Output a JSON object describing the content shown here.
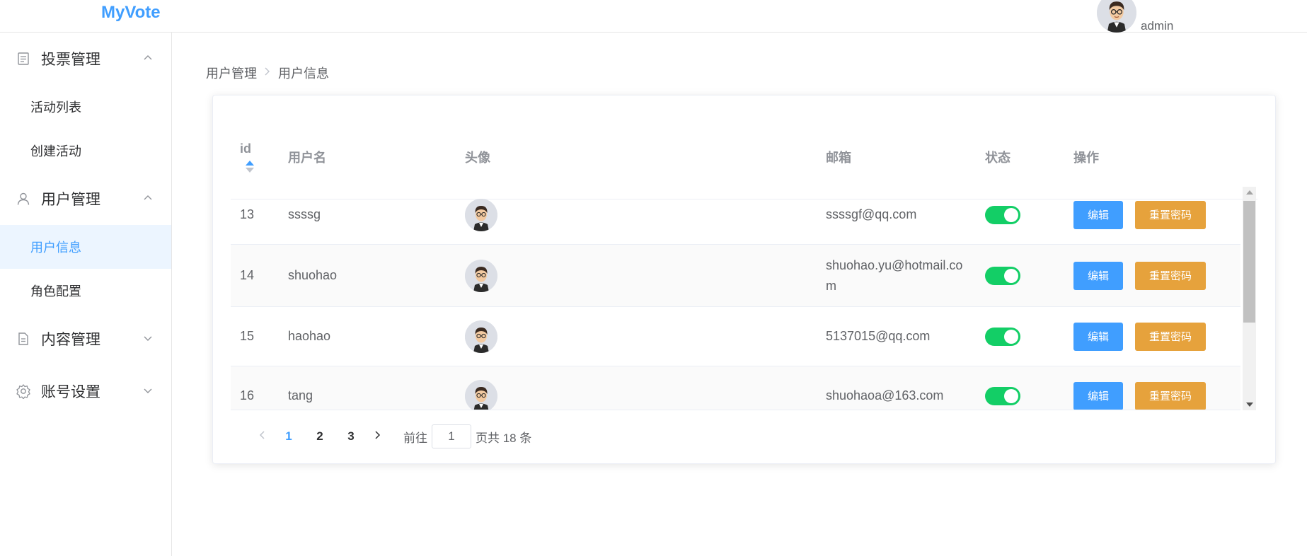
{
  "app": {
    "title": "MyVote"
  },
  "header": {
    "username": "admin"
  },
  "sidebar": {
    "groups": [
      {
        "title": "投票管理",
        "icon": "document-icon",
        "expanded": true,
        "items": [
          {
            "label": "活动列表"
          },
          {
            "label": "创建活动"
          }
        ]
      },
      {
        "title": "用户管理",
        "icon": "user-icon",
        "expanded": true,
        "items": [
          {
            "label": "用户信息",
            "active": true
          },
          {
            "label": "角色配置"
          }
        ]
      },
      {
        "title": "内容管理",
        "icon": "document-icon",
        "expanded": false,
        "items": []
      },
      {
        "title": "账号设置",
        "icon": "gear-icon",
        "expanded": false,
        "items": []
      }
    ]
  },
  "breadcrumb": {
    "parent": "用户管理",
    "current": "用户信息"
  },
  "table": {
    "columns": {
      "id": "id",
      "username": "用户名",
      "avatar": "头像",
      "email": "邮箱",
      "status": "状态",
      "actions": "操作"
    },
    "rows": [
      {
        "id": "13",
        "username": "ssssg",
        "email": "ssssgf@qq.com",
        "enabled": true
      },
      {
        "id": "14",
        "username": "shuohao",
        "email": "shuohao.yu@hotmail.com",
        "enabled": true
      },
      {
        "id": "15",
        "username": "haohao",
        "email": "5137015@qq.com",
        "enabled": true
      },
      {
        "id": "16",
        "username": "tang",
        "email": "shuohaoa@163.com",
        "enabled": true
      }
    ],
    "edit_label": "编辑",
    "reset_label": "重置密码"
  },
  "pagination": {
    "pages": [
      "1",
      "2",
      "3"
    ],
    "current": "1",
    "goto_prefix": "前往",
    "goto_value": "1",
    "goto_suffix": "页共 18 条"
  },
  "colors": {
    "primary": "#409eff",
    "warning": "#e6a23c",
    "switch_on": "#13ce66",
    "active_menu_bg": "#ecf5ff"
  }
}
